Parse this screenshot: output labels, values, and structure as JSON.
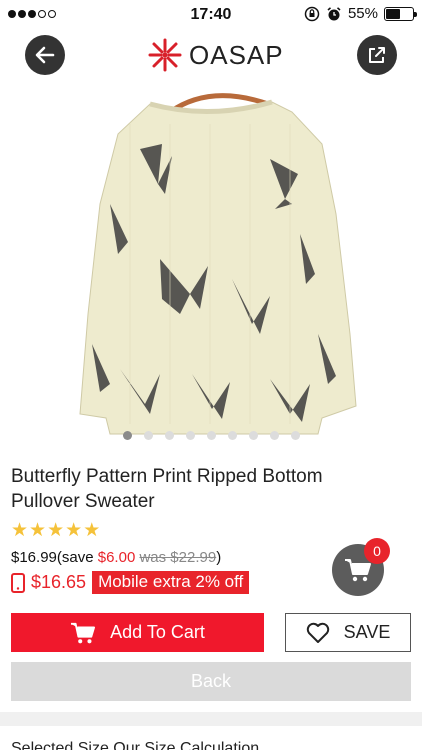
{
  "status_bar": {
    "time": "17:40",
    "battery": "55%",
    "battery_level": 0.55
  },
  "header": {
    "brand": "OASAP",
    "back_icon": "arrow-left-icon",
    "share_icon": "share-icon"
  },
  "product": {
    "title": "Butterfly Pattern Print Ripped Bottom Pullover Sweater",
    "image_count": 9,
    "active_image": 1,
    "rating": 5,
    "price": "$16.99",
    "save_prefix": "(save ",
    "save_amount": "$6.00",
    "was_price": "was $22.99",
    "save_suffix": ")",
    "mobile_price": "$16.65",
    "mobile_tag": "Mobile extra 2% off"
  },
  "cart": {
    "count": "0"
  },
  "actions": {
    "add_to_cart": "Add To Cart",
    "save": "SAVE",
    "back": "Back"
  },
  "footer": {
    "partial_text": "Selected Size Our Size Calculation"
  },
  "colors": {
    "accent": "#e8242b",
    "button_red": "#f0182c",
    "star": "#f5c23a"
  }
}
